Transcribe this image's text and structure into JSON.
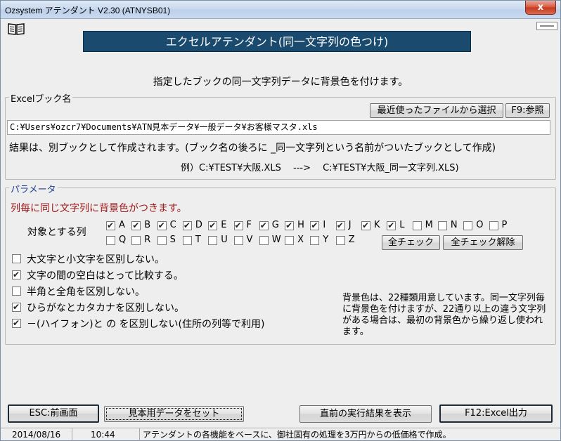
{
  "window": {
    "title": "Ozsystem アテンダント V2.30 (ATNYSB01)",
    "close_label": "x"
  },
  "banner": {
    "title": "エクセルアテンダント(同一文字列の色つけ)"
  },
  "subtitle": "指定したブックの同一文字列データに背景色を付けます。",
  "excel_group": {
    "label": "Excelブック名",
    "recent_button": "最近使ったファイルから選択",
    "browse_button": "F9:参照",
    "path_value": "C:¥Users¥ozcr7¥Documents¥ATN見本データ¥一般データ¥お客様マスタ.xls",
    "result_note": "結果は、別ブックとして作成されます。(ブック名の後ろに _同一文字列という名前がついたブックとして作成)",
    "example": "例）C:¥TEST¥大阪.XLS　 --->　 C:¥TEST¥大阪_同一文字列.XLS)"
  },
  "param_group": {
    "label": "パラメータ",
    "headline": "列毎に同じ文字列に背景色がつきます。",
    "columns_label": "対象とする列",
    "columns_row1": [
      {
        "label": "A",
        "checked": true
      },
      {
        "label": "B",
        "checked": true
      },
      {
        "label": "C",
        "checked": true
      },
      {
        "label": "D",
        "checked": true
      },
      {
        "label": "E",
        "checked": true
      },
      {
        "label": "F",
        "checked": true
      },
      {
        "label": "G",
        "checked": true
      },
      {
        "label": "H",
        "checked": true
      },
      {
        "label": "I",
        "checked": true
      },
      {
        "label": "J",
        "checked": true
      },
      {
        "label": "K",
        "checked": true
      },
      {
        "label": "L",
        "checked": true
      },
      {
        "label": "M",
        "checked": false
      },
      {
        "label": "N",
        "checked": false
      },
      {
        "label": "O",
        "checked": false
      },
      {
        "label": "P",
        "checked": false
      }
    ],
    "columns_row2": [
      {
        "label": "Q",
        "checked": false
      },
      {
        "label": "R",
        "checked": false
      },
      {
        "label": "S",
        "checked": false
      },
      {
        "label": "T",
        "checked": false
      },
      {
        "label": "U",
        "checked": false
      },
      {
        "label": "V",
        "checked": false
      },
      {
        "label": "W",
        "checked": false
      },
      {
        "label": "X",
        "checked": false
      },
      {
        "label": "Y",
        "checked": false
      },
      {
        "label": "Z",
        "checked": false
      }
    ],
    "check_all_button": "全チェック",
    "uncheck_all_button": "全チェック解除",
    "options": [
      {
        "label": "大文字と小文字を区別しない。",
        "checked": false
      },
      {
        "label": "文字の間の空白はとって比較する。",
        "checked": true
      },
      {
        "label": "半角と全角を区別しない。",
        "checked": false
      },
      {
        "label": "ひらがなとカタカナを区別しない。",
        "checked": true
      },
      {
        "label": "－(ハイフォン)と の を区別しない(住所の列等で利用)",
        "checked": true
      }
    ],
    "note": "背景色は、22種類用意しています。同一文字列毎に背景色を付けますが、22通り以上の違う文字列がある場合は、最初の背景色から繰り返し使われます。"
  },
  "footer_buttons": {
    "esc": "ESC:前画面",
    "sample": "見本用データをセット",
    "last_result": "直前の実行結果を表示",
    "output": "F12:Excel出力"
  },
  "statusbar": {
    "date": "2014/08/16",
    "time": "10:44",
    "message": "アテンダントの各機能をベースに、御社固有の処理を3万円からの低価格で作成。"
  },
  "colors": {
    "banner_bg": "#1a4a6e",
    "headline_red": "#a01818",
    "group_label_blue": "#1f3f8f"
  }
}
